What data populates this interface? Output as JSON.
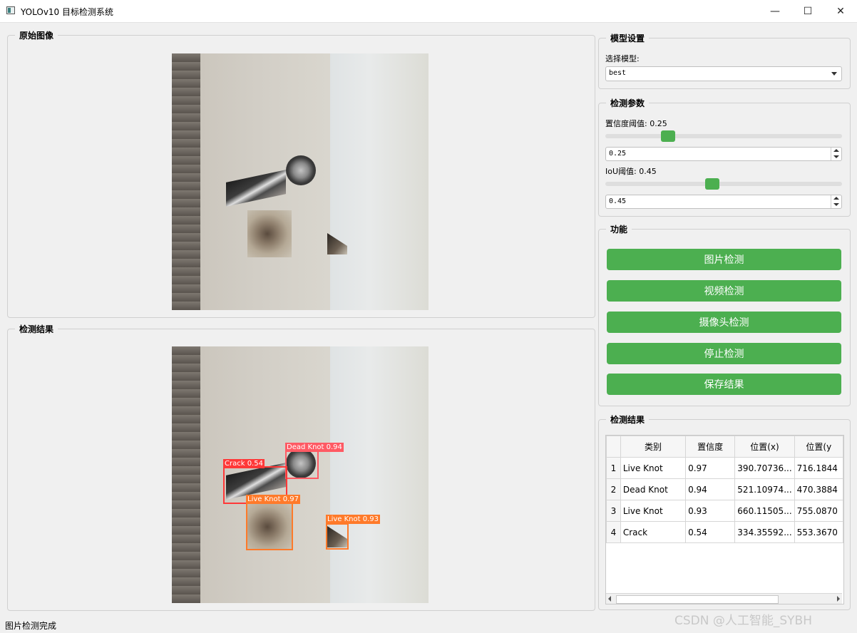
{
  "window": {
    "title": "YOLOv10 目标检测系统",
    "minimize": "—",
    "maximize": "☐",
    "close": "✕"
  },
  "panels": {
    "original_title": "原始图像",
    "result_image_title": "检测结果"
  },
  "detections": [
    {
      "label": "Dead Knot 0.94",
      "color": "#ff5a64"
    },
    {
      "label": "Crack 0.54",
      "color": "#ff3838"
    },
    {
      "label": "Live Knot 0.97",
      "color": "#ff7a2a"
    },
    {
      "label": "Live Knot 0.93",
      "color": "#ff7a2a"
    }
  ],
  "model_settings": {
    "title": "模型设置",
    "select_label": "选择模型:",
    "selected_model": "best"
  },
  "detect_params": {
    "title": "检测参数",
    "conf_label": "置信度阈值: 0.25",
    "conf_value": "0.25",
    "conf_slider": 0.25,
    "iou_label": "IoU阈值: 0.45",
    "iou_value": "0.45",
    "iou_slider": 0.45
  },
  "functions": {
    "title": "功能",
    "image_detect": "图片检测",
    "video_detect": "视频检测",
    "camera_detect": "摄像头检测",
    "stop_detect": "停止检测",
    "save_result": "保存结果"
  },
  "results_table": {
    "title": "检测结果",
    "headers": [
      "类别",
      "置信度",
      "位置(x)",
      "位置(y"
    ],
    "rows": [
      [
        "1",
        "Live Knot",
        "0.97",
        "390.70736...",
        "716.1844"
      ],
      [
        "2",
        "Dead Knot",
        "0.94",
        "521.10974...",
        "470.3884"
      ],
      [
        "3",
        "Live Knot",
        "0.93",
        "660.11505...",
        "755.0870"
      ],
      [
        "4",
        "Crack",
        "0.54",
        "334.35592...",
        "553.3670"
      ]
    ]
  },
  "status": "图片检测完成",
  "watermark": "CSDN @人工智能_SYBH",
  "colors": {
    "accent_green": "#4caf50"
  }
}
